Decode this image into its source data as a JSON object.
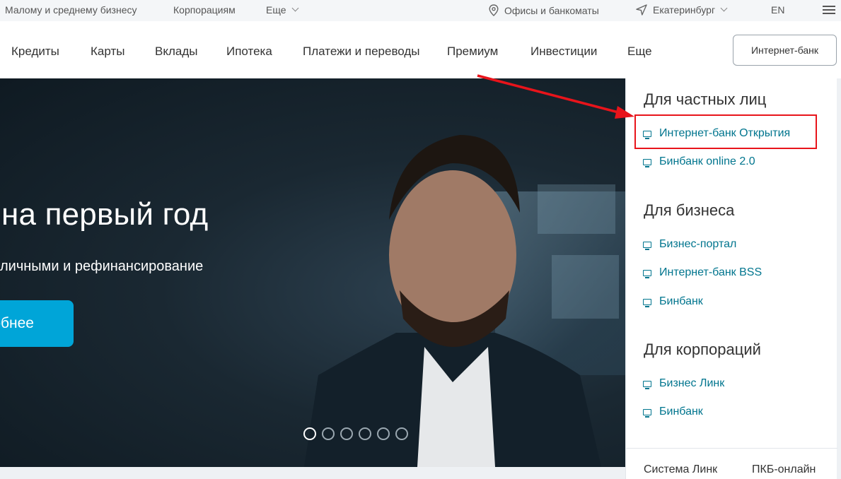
{
  "topbar": {
    "business": "Малому и среднему бизнесу",
    "corporations": "Корпорациям",
    "more": "Еще",
    "offices": "Офисы и банкоматы",
    "city": "Екатеринбург",
    "lang": "EN"
  },
  "mainnav": {
    "items": [
      "Кредиты",
      "Карты",
      "Вклады",
      "Ипотека",
      "Платежи и переводы",
      "Премиум",
      "Инвестиции",
      "Еще"
    ],
    "internet_bank_button": "Интернет-банк"
  },
  "hero": {
    "headline": "на первый год",
    "subline": "личными и рефинансирование",
    "cta": "обнее",
    "slides_total": 6,
    "active_slide": 1
  },
  "dropdown": {
    "sections": [
      {
        "title": "Для частных лиц",
        "links": [
          "Интернет-банк Открытия",
          "Бинбанк online 2.0"
        ]
      },
      {
        "title": "Для бизнеса",
        "links": [
          "Бизнес-портал",
          "Интернет-банк BSS",
          "Бинбанк"
        ]
      },
      {
        "title": "Для корпораций",
        "links": [
          "Бизнес Линк",
          "Бинбанк"
        ]
      }
    ],
    "footer": [
      "Система Линк",
      "ПКБ-онлайн"
    ]
  },
  "colors": {
    "link": "#00758e",
    "cta": "#00a5d8",
    "annotation": "#e8141b"
  }
}
